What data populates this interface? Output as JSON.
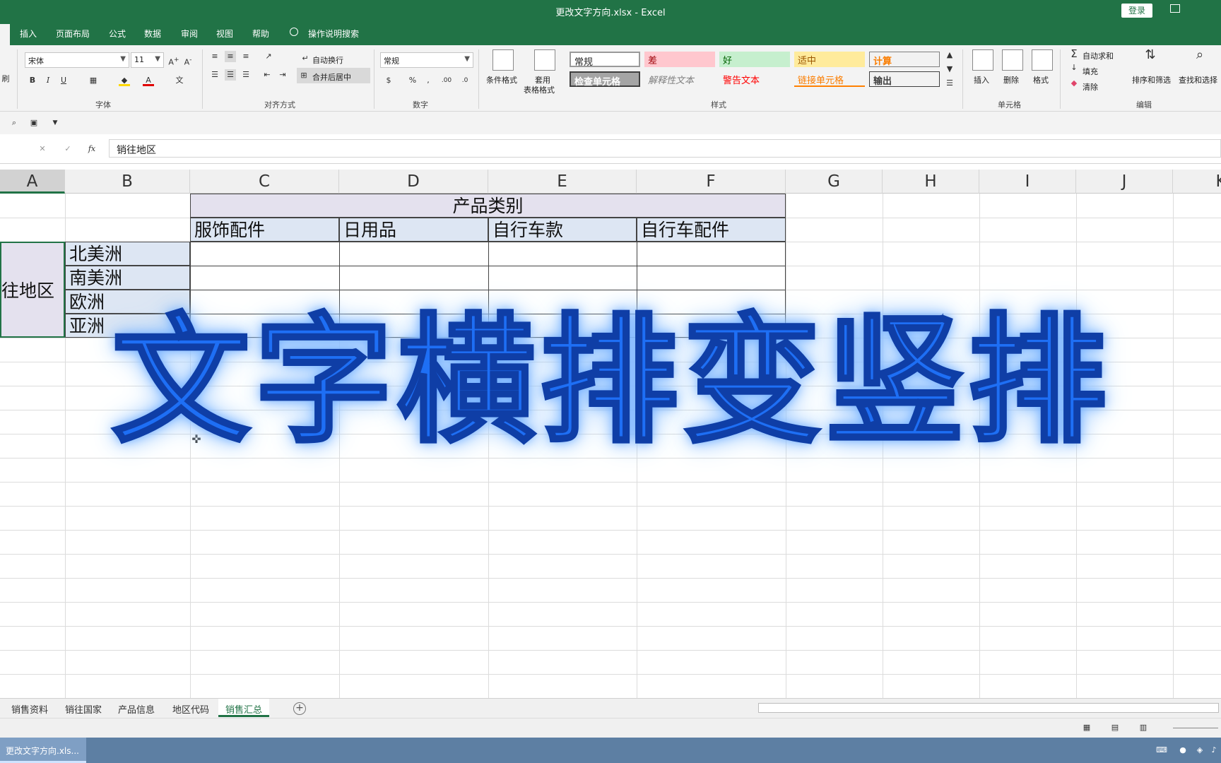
{
  "window": {
    "title": "更改文字方向.xlsx  -  Excel",
    "login": "登录"
  },
  "ribbon_tabs": [
    "插入",
    "页面布局",
    "公式",
    "数据",
    "审阅",
    "视图",
    "帮助"
  ],
  "tell_me": "操作说明搜索",
  "font": {
    "name": "宋体",
    "size": "11",
    "group_label": "字体"
  },
  "alignment": {
    "wrap": "自动换行",
    "merge": "合并后居中",
    "group_label": "对齐方式"
  },
  "number": {
    "format": "常规",
    "group_label": "数字"
  },
  "styles": {
    "conditional": "条件格式",
    "table_format_1": "套用",
    "table_format_2": "表格格式",
    "cells": [
      {
        "label": "常规"
      },
      {
        "label": "差"
      },
      {
        "label": "好"
      },
      {
        "label": "适中"
      },
      {
        "label": "计算"
      },
      {
        "label": "检查单元格"
      },
      {
        "label": "解释性文本"
      },
      {
        "label": "警告文本"
      },
      {
        "label": "链接单元格"
      },
      {
        "label": "输出"
      }
    ],
    "group_label": "样式"
  },
  "cells_group": {
    "insert": "插入",
    "delete": "删除",
    "format": "格式",
    "group_label": "单元格"
  },
  "editing": {
    "autosum": "自动求和",
    "fill": "填充",
    "clear": "清除",
    "sort": "排序和筛选",
    "find": "查找和选择",
    "group_label": "编辑"
  },
  "formula_bar": {
    "fx": "fx",
    "content": "销往地区"
  },
  "columns": [
    "A",
    "B",
    "C",
    "D",
    "E",
    "F",
    "G",
    "H",
    "I",
    "J",
    "K"
  ],
  "table": {
    "header": "产品类别",
    "categories": [
      "服饰配件",
      "日用品",
      "自行车款",
      "自行车配件"
    ],
    "row_group": "往地区",
    "regions": [
      "北美洲",
      "南美洲",
      "欧洲",
      "亚洲"
    ]
  },
  "overlay_text": "文字横排变竖排",
  "sheets": [
    "销售资料",
    "销往国家",
    "产品信息",
    "地区代码",
    "销售汇总"
  ],
  "active_sheet": "销售汇总",
  "taskbar": {
    "item": "更改文字方向.xls..."
  },
  "colors": {
    "excel_green": "#217346",
    "overlay_blue": "#1e6ff5",
    "header_fill": "#e4e1ee",
    "cell_fill": "#dde6f3"
  }
}
